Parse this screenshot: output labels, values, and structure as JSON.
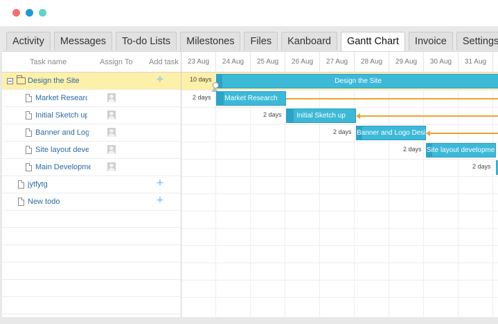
{
  "window": {
    "controls": [
      "close",
      "minimize",
      "maximize"
    ]
  },
  "tabs": [
    {
      "label": "Activity",
      "active": false
    },
    {
      "label": "Messages",
      "active": false
    },
    {
      "label": "To-do Lists",
      "active": false
    },
    {
      "label": "Milestones",
      "active": false
    },
    {
      "label": "Files",
      "active": false
    },
    {
      "label": "Kanboard",
      "active": false
    },
    {
      "label": "Gantt Chart",
      "active": true
    },
    {
      "label": "Invoice",
      "active": false
    },
    {
      "label": "Settings",
      "active": false
    }
  ],
  "grid": {
    "columns": {
      "task_name": "Task name",
      "assign_to": "Assign To",
      "add_task": "Add task"
    },
    "rows": [
      {
        "name": "Design the Site",
        "type": "folder",
        "selected": true
      },
      {
        "name": "Market Research",
        "type": "file"
      },
      {
        "name": "Initial Sketch up",
        "type": "file"
      },
      {
        "name": "Banner and Logo D",
        "type": "file"
      },
      {
        "name": "Site layout develop",
        "type": "file"
      },
      {
        "name": "Main Development",
        "type": "file"
      },
      {
        "name": "jytfytg",
        "type": "file"
      },
      {
        "name": "New todo",
        "type": "file"
      }
    ]
  },
  "timeline": {
    "days": [
      "23 Aug",
      "24 Aug",
      "25 Aug",
      "26 Aug",
      "27 Aug",
      "28 Aug",
      "29 Aug",
      "30 Aug",
      "31 Aug"
    ],
    "bars": [
      {
        "label": "Design the Site",
        "duration": "10 days"
      },
      {
        "label": "Market Research",
        "duration": "2 days"
      },
      {
        "label": "Initial Sketch up",
        "duration": "2 days"
      },
      {
        "label": "Banner and Logo Design",
        "duration": "2 days"
      },
      {
        "label": "Site layout development",
        "duration": "2 days"
      },
      {
        "label": "",
        "duration": "2 days"
      }
    ]
  },
  "colors": {
    "bar": "#3db9d8",
    "bar_progress": "#2ba4c6",
    "selected_row": "#fdf0a8",
    "link": "#f0a030",
    "add_icon": "#8fd3ec"
  }
}
